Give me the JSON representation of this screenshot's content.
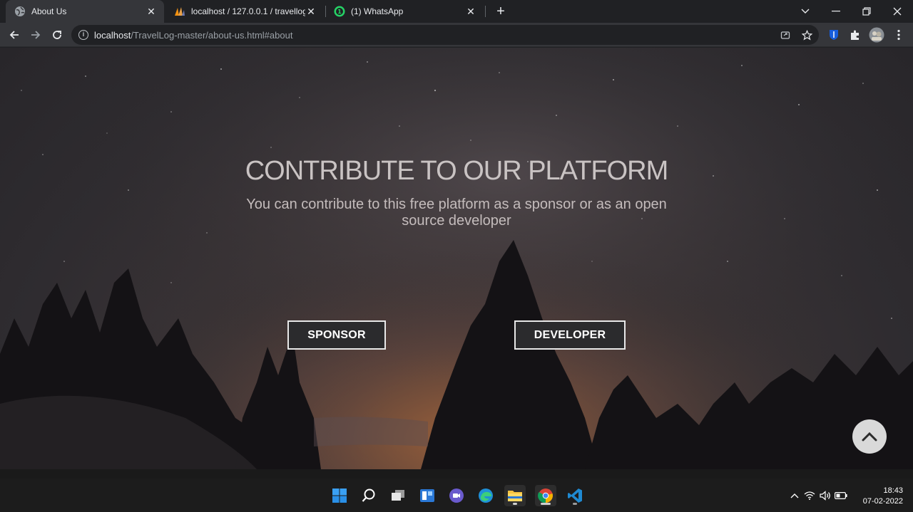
{
  "browser": {
    "tabs": [
      {
        "title": "About Us",
        "favicon": "globe-icon",
        "active": true
      },
      {
        "title": "localhost / 127.0.0.1 / travellog | ",
        "favicon": "phpmyadmin-icon",
        "active": false
      },
      {
        "title": "(1) WhatsApp",
        "favicon": "whatsapp-icon",
        "active": false,
        "badge": "1"
      }
    ],
    "url_host": "localhost",
    "url_path": "/TravelLog-master/about-us.html#about"
  },
  "page": {
    "title": "CONTRIBUTE TO OUR PLATFORM",
    "subtitle": "You can contribute to this free platform as a sponsor or as an open source developer",
    "sponsor_label": "SPONSOR",
    "developer_label": "DEVELOPER"
  },
  "taskbar": {
    "apps": [
      "windows-start-icon",
      "search-icon",
      "task-view-icon",
      "widgets-icon",
      "teams-chat-icon",
      "edge-icon",
      "file-explorer-icon",
      "chrome-icon",
      "vscode-icon"
    ],
    "time": "18:43",
    "date": "07-02-2022"
  },
  "colors": {
    "tab_bar": "#202124",
    "toolbar": "#35363a",
    "button_bg": "#2b2b2d",
    "taskbar": "#1c1c1c"
  }
}
